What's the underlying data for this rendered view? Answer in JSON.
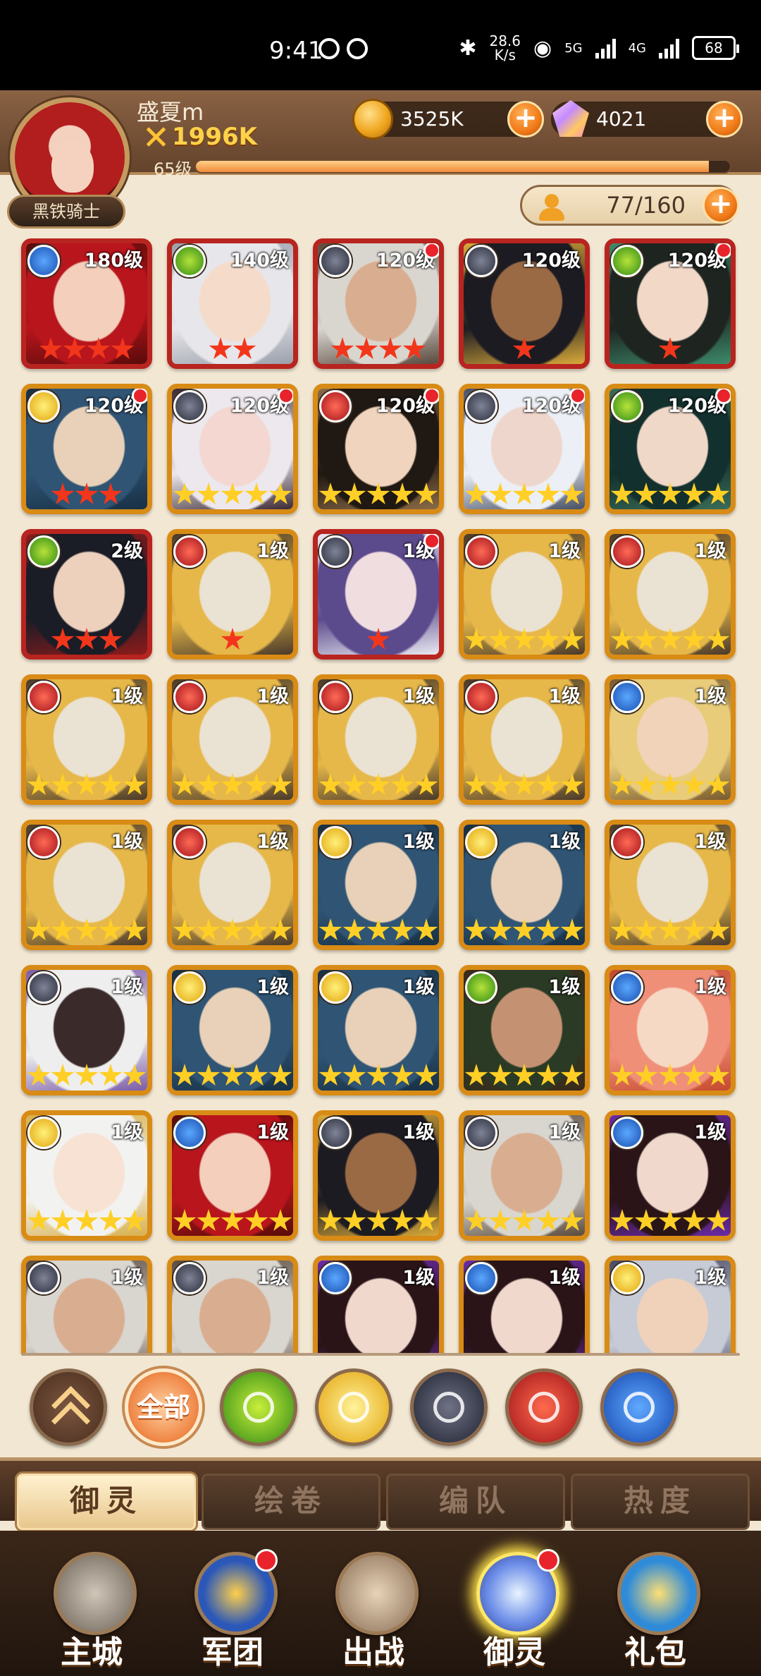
{
  "status_bar": {
    "time": "9:41",
    "speed_top": "28.6",
    "speed_bottom": "K/s",
    "net1": "5G",
    "net2": "4G",
    "battery": "68"
  },
  "player": {
    "name": "盛夏m",
    "power": "1996K",
    "title": "黑铁骑士",
    "level": "65级",
    "exp_fraction": 0.96
  },
  "currency": {
    "gold": "3525K",
    "gems": "4021"
  },
  "capacity": "77/160",
  "cards": [
    {
      "element": "water",
      "level": "180级",
      "stars": 4,
      "star_color": "red",
      "rarity": "red",
      "dot": false,
      "art": "red-haired-woman"
    },
    {
      "element": "wood",
      "level": "140级",
      "stars": 2,
      "star_color": "red",
      "rarity": "red",
      "dot": false,
      "art": "silver-haired-girl"
    },
    {
      "element": "dark",
      "level": "120级",
      "stars": 4,
      "star_color": "red",
      "rarity": "red",
      "dot": true,
      "art": "old-man-glasses"
    },
    {
      "element": "dark",
      "level": "120级",
      "stars": 1,
      "star_color": "red",
      "rarity": "red",
      "dot": false,
      "art": "pharaoh-woman"
    },
    {
      "element": "wood",
      "level": "120级",
      "stars": 1,
      "star_color": "red",
      "rarity": "red",
      "dot": true,
      "art": "dark-haired-woman"
    },
    {
      "element": "light",
      "level": "120级",
      "stars": 3,
      "star_color": "red",
      "rarity": "gold",
      "dot": true,
      "art": "helmet-knight"
    },
    {
      "element": "dark",
      "level": "120级",
      "stars": 5,
      "star_color": "gold",
      "rarity": "gold",
      "dot": true,
      "art": "white-haired-girl"
    },
    {
      "element": "fire",
      "level": "120级",
      "stars": 5,
      "star_color": "gold",
      "rarity": "gold",
      "dot": true,
      "art": "black-haired-woman"
    },
    {
      "element": "dark",
      "level": "120级",
      "stars": 5,
      "star_color": "gold",
      "rarity": "gold",
      "dot": true,
      "art": "white-haired-man"
    },
    {
      "element": "wood",
      "level": "120级",
      "stars": 5,
      "star_color": "gold",
      "rarity": "gold",
      "dot": true,
      "art": "green-haired-woman"
    },
    {
      "element": "wood",
      "level": "2级",
      "stars": 3,
      "star_color": "red",
      "rarity": "red",
      "dot": false,
      "art": "dark-haired-man"
    },
    {
      "element": "fire",
      "level": "1级",
      "stars": 1,
      "star_color": "red",
      "rarity": "gold",
      "dot": false,
      "art": "masked-warrior"
    },
    {
      "element": "dark",
      "level": "1级",
      "stars": 1,
      "star_color": "red",
      "rarity": "red",
      "dot": true,
      "art": "hooded-woman"
    },
    {
      "element": "fire",
      "level": "1级",
      "stars": 5,
      "star_color": "gold",
      "rarity": "gold",
      "dot": false,
      "art": "masked-warrior"
    },
    {
      "element": "fire",
      "level": "1级",
      "stars": 5,
      "star_color": "gold",
      "rarity": "gold",
      "dot": false,
      "art": "masked-warrior"
    },
    {
      "element": "fire",
      "level": "1级",
      "stars": 5,
      "star_color": "gold",
      "rarity": "gold",
      "dot": false,
      "art": "masked-warrior"
    },
    {
      "element": "fire",
      "level": "1级",
      "stars": 5,
      "star_color": "gold",
      "rarity": "gold",
      "dot": false,
      "art": "masked-warrior"
    },
    {
      "element": "fire",
      "level": "1级",
      "stars": 5,
      "star_color": "gold",
      "rarity": "gold",
      "dot": false,
      "art": "masked-warrior"
    },
    {
      "element": "fire",
      "level": "1级",
      "stars": 5,
      "star_color": "gold",
      "rarity": "gold",
      "dot": false,
      "art": "masked-warrior"
    },
    {
      "element": "water",
      "level": "1级",
      "stars": 5,
      "star_color": "gold",
      "rarity": "gold",
      "dot": false,
      "art": "blond-man"
    },
    {
      "element": "fire",
      "level": "1级",
      "stars": 5,
      "star_color": "gold",
      "rarity": "gold",
      "dot": false,
      "art": "masked-warrior"
    },
    {
      "element": "fire",
      "level": "1级",
      "stars": 5,
      "star_color": "gold",
      "rarity": "gold",
      "dot": false,
      "art": "masked-warrior"
    },
    {
      "element": "light",
      "level": "1级",
      "stars": 5,
      "star_color": "gold",
      "rarity": "gold",
      "dot": false,
      "art": "helmet-knight"
    },
    {
      "element": "light",
      "level": "1级",
      "stars": 5,
      "star_color": "gold",
      "rarity": "gold",
      "dot": false,
      "art": "helmet-knight"
    },
    {
      "element": "fire",
      "level": "1级",
      "stars": 5,
      "star_color": "gold",
      "rarity": "gold",
      "dot": false,
      "art": "masked-warrior"
    },
    {
      "element": "dark",
      "level": "1级",
      "stars": 5,
      "star_color": "gold",
      "rarity": "gold",
      "dot": false,
      "art": "dark-skinned-man"
    },
    {
      "element": "light",
      "level": "1级",
      "stars": 5,
      "star_color": "gold",
      "rarity": "gold",
      "dot": false,
      "art": "helmet-knight"
    },
    {
      "element": "light",
      "level": "1级",
      "stars": 5,
      "star_color": "gold",
      "rarity": "gold",
      "dot": false,
      "art": "helmet-knight"
    },
    {
      "element": "wood",
      "level": "1级",
      "stars": 5,
      "star_color": "gold",
      "rarity": "gold",
      "dot": false,
      "art": "bearded-warrior"
    },
    {
      "element": "water",
      "level": "1级",
      "stars": 5,
      "star_color": "gold",
      "rarity": "gold",
      "dot": false,
      "art": "pink-haired-woman"
    },
    {
      "element": "light",
      "level": "1级",
      "stars": 5,
      "star_color": "gold",
      "rarity": "gold",
      "dot": false,
      "art": "crowned-girl"
    },
    {
      "element": "water",
      "level": "1级",
      "stars": 5,
      "star_color": "gold",
      "rarity": "gold",
      "dot": false,
      "art": "red-haired-woman"
    },
    {
      "element": "dark",
      "level": "1级",
      "stars": 5,
      "star_color": "gold",
      "rarity": "gold",
      "dot": false,
      "art": "pharaoh-woman"
    },
    {
      "element": "dark",
      "level": "1级",
      "stars": 5,
      "star_color": "gold",
      "rarity": "gold",
      "dot": false,
      "art": "old-man-glasses"
    },
    {
      "element": "water",
      "level": "1级",
      "stars": 5,
      "star_color": "gold",
      "rarity": "gold",
      "dot": false,
      "art": "vampire-man"
    },
    {
      "element": "dark",
      "level": "1级",
      "stars": 0,
      "star_color": "gold",
      "rarity": "gold",
      "dot": false,
      "art": "old-man-glasses"
    },
    {
      "element": "dark",
      "level": "1级",
      "stars": 0,
      "star_color": "gold",
      "rarity": "gold",
      "dot": false,
      "art": "old-man-glasses"
    },
    {
      "element": "water",
      "level": "1级",
      "stars": 0,
      "star_color": "gold",
      "rarity": "gold",
      "dot": false,
      "art": "vampire-man"
    },
    {
      "element": "water",
      "level": "1级",
      "stars": 0,
      "star_color": "gold",
      "rarity": "gold",
      "dot": false,
      "art": "vampire-man"
    },
    {
      "element": "light",
      "level": "1级",
      "stars": 0,
      "star_color": "gold",
      "rarity": "gold",
      "dot": false,
      "art": "silver-haired-man"
    }
  ],
  "filters": {
    "all_label": "全部",
    "items": [
      "collapse",
      "all",
      "wood",
      "light",
      "dark",
      "fire",
      "water"
    ]
  },
  "tabs": [
    "御灵",
    "绘卷",
    "编队",
    "热度"
  ],
  "active_tab": 0,
  "nav": [
    {
      "label": "主城",
      "icon": "castle-icon",
      "dot": false
    },
    {
      "label": "军团",
      "icon": "fist-shield-icon",
      "dot": true
    },
    {
      "label": "出战",
      "icon": "sword-gate-icon",
      "dot": false
    },
    {
      "label": "御灵",
      "icon": "crystal-icon",
      "dot": true
    },
    {
      "label": "礼包",
      "icon": "shop-icon",
      "dot": false
    }
  ],
  "active_nav": 3,
  "colors": {
    "star_gold": "#ffcf26",
    "star_red": "#f2361b",
    "rarity_red": "#b8241f",
    "rarity_gold": "#d88b15",
    "accent_orange": "#f07a18"
  }
}
